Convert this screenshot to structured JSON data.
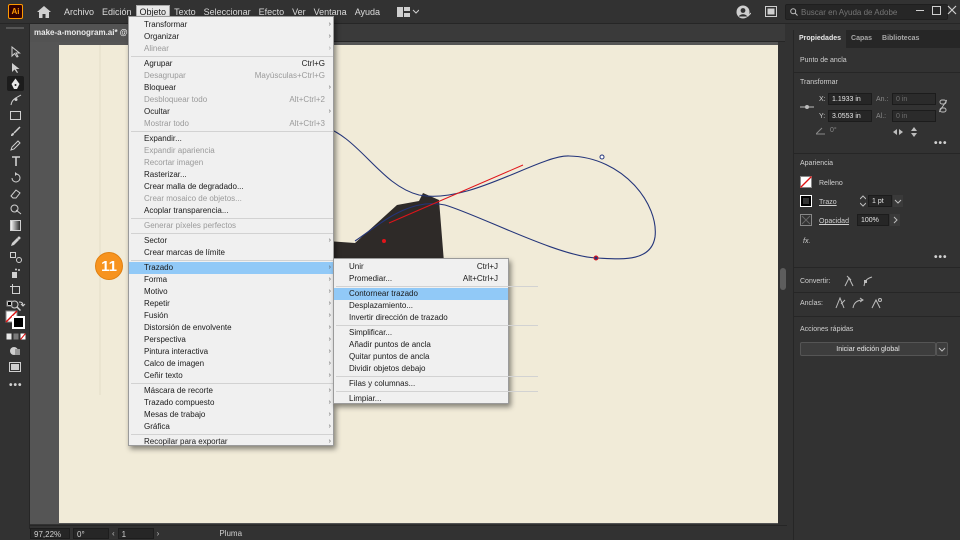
{
  "app": {
    "logo": "Ai",
    "accent": "#ff9a00"
  },
  "menubar": {
    "items": [
      "Archivo",
      "Edición",
      "Objeto",
      "Texto",
      "Seleccionar",
      "Efecto",
      "Ver",
      "Ventana",
      "Ayuda"
    ],
    "active": "Objeto"
  },
  "search": {
    "placeholder": "Buscar en Ayuda de Adobe"
  },
  "document": {
    "tab_title": "make-a-monogram.ai* @ 9"
  },
  "status": {
    "zoom": "97,22%",
    "rotation": "0°",
    "artboard": "1",
    "tool": "Pluma"
  },
  "panel": {
    "tabs": [
      "Propiedades",
      "Capas",
      "Bibliotecas"
    ],
    "active_tab": "Propiedades",
    "section_anchor": "Punto de ancla",
    "transform": {
      "title": "Transformar",
      "x_label": "X:",
      "x_value": "1.1933 in",
      "y_label": "Y:",
      "y_value": "3.0553 in",
      "w_label": "An.:",
      "w_value": "0 in",
      "h_label": "Al.:",
      "h_value": "0 in",
      "angle_value": "0°"
    },
    "appearance": {
      "title": "Apariencia",
      "fill_label": "Relleno",
      "stroke_label": "Trazo",
      "stroke_value": "1 pt",
      "opacity_label": "Opacidad",
      "opacity_value": "100%",
      "fx_label": "fx."
    },
    "convert_label": "Convertir:",
    "anchors_label": "Anclas:",
    "quick_actions": {
      "title": "Acciones rápidas",
      "button": "Iniciar edición global"
    }
  },
  "object_menu": {
    "items": [
      {
        "label": "Transformar",
        "submenu": true
      },
      {
        "label": "Organizar",
        "submenu": true
      },
      {
        "label": "Alinear",
        "submenu": true,
        "disabled": true
      },
      {
        "sep": true
      },
      {
        "label": "Agrupar",
        "shortcut": "Ctrl+G"
      },
      {
        "label": "Desagrupar",
        "shortcut": "Mayúsculas+Ctrl+G",
        "disabled": true
      },
      {
        "label": "Bloquear",
        "submenu": true
      },
      {
        "label": "Desbloquear todo",
        "shortcut": "Alt+Ctrl+2",
        "disabled": true
      },
      {
        "label": "Ocultar",
        "submenu": true
      },
      {
        "label": "Mostrar todo",
        "shortcut": "Alt+Ctrl+3",
        "disabled": true
      },
      {
        "sep": true
      },
      {
        "label": "Expandir..."
      },
      {
        "label": "Expandir apariencia",
        "disabled": true
      },
      {
        "label": "Recortar imagen",
        "disabled": true
      },
      {
        "label": "Rasterizar..."
      },
      {
        "label": "Crear malla de degradado..."
      },
      {
        "label": "Crear mosaico de objetos...",
        "disabled": true
      },
      {
        "label": "Acoplar transparencia..."
      },
      {
        "sep": true
      },
      {
        "label": "Generar píxeles perfectos",
        "disabled": true
      },
      {
        "sep": true
      },
      {
        "label": "Sector",
        "submenu": true
      },
      {
        "label": "Crear marcas de límite"
      },
      {
        "sep": true
      },
      {
        "label": "Trazado",
        "submenu": true,
        "highlight": true
      },
      {
        "label": "Forma",
        "submenu": true
      },
      {
        "label": "Motivo",
        "submenu": true
      },
      {
        "label": "Repetir",
        "submenu": true
      },
      {
        "label": "Fusión",
        "submenu": true
      },
      {
        "label": "Distorsión de envolvente",
        "submenu": true
      },
      {
        "label": "Perspectiva",
        "submenu": true
      },
      {
        "label": "Pintura interactiva",
        "submenu": true
      },
      {
        "label": "Calco de imagen",
        "submenu": true
      },
      {
        "label": "Ceñir texto",
        "submenu": true
      },
      {
        "sep": true
      },
      {
        "label": "Máscara de recorte",
        "submenu": true
      },
      {
        "label": "Trazado compuesto",
        "submenu": true
      },
      {
        "label": "Mesas de trabajo",
        "submenu": true
      },
      {
        "label": "Gráfica",
        "submenu": true
      },
      {
        "sep": true
      },
      {
        "label": "Recopilar para exportar",
        "submenu": true
      }
    ]
  },
  "trazado_submenu": {
    "items": [
      {
        "label": "Unir",
        "shortcut": "Ctrl+J"
      },
      {
        "label": "Promediar...",
        "shortcut": "Alt+Ctrl+J"
      },
      {
        "sep": true
      },
      {
        "label": "Contornear trazado",
        "highlight": true
      },
      {
        "label": "Desplazamiento..."
      },
      {
        "label": "Invertir dirección de trazado"
      },
      {
        "sep": true
      },
      {
        "label": "Simplificar..."
      },
      {
        "label": "Añadir puntos de ancla"
      },
      {
        "label": "Quitar puntos de ancla"
      },
      {
        "label": "Dividir objetos debajo"
      },
      {
        "sep": true
      },
      {
        "label": "Filas y columnas..."
      },
      {
        "sep": true
      },
      {
        "label": "Limpiar..."
      }
    ]
  },
  "step_badge": "11"
}
